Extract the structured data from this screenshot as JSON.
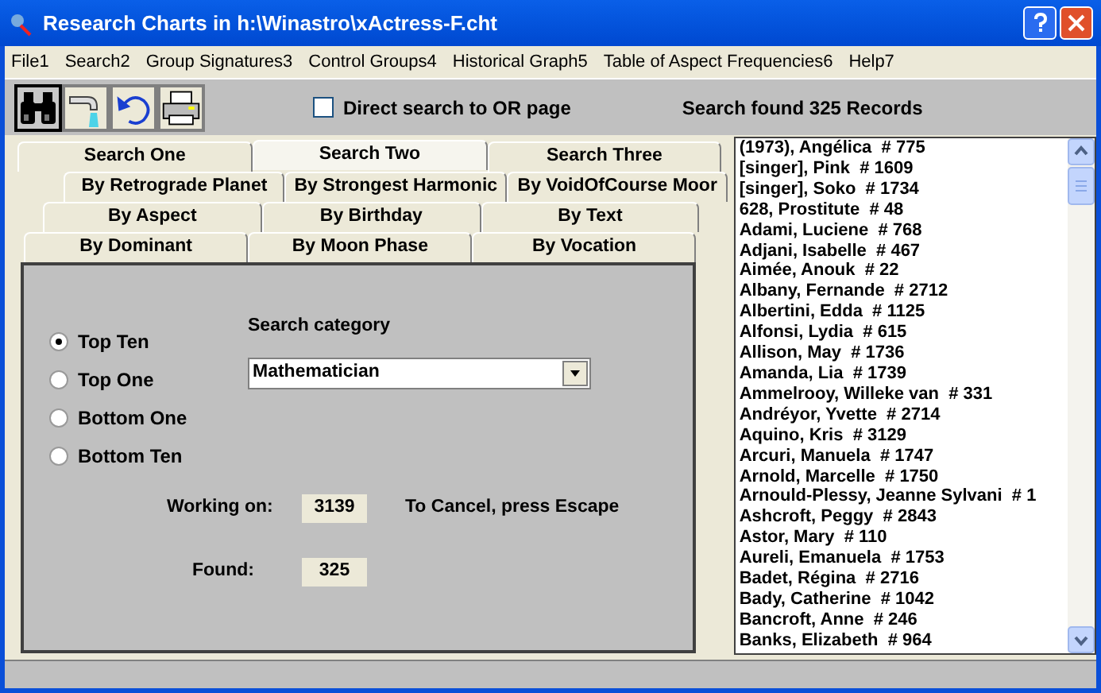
{
  "window": {
    "title": "Research Charts in h:\\Winastro\\xActress-F.cht"
  },
  "menu": [
    "File1",
    "Search2",
    "Group Signatures3",
    "Control Groups4",
    "Historical Graph5",
    "Table of Aspect Frequencies6",
    "Help7"
  ],
  "toolbar": {
    "buttons": [
      {
        "kind": "binoculars",
        "selected": true
      },
      {
        "kind": "pour",
        "selected": false
      },
      {
        "kind": "undo",
        "selected": false
      },
      {
        "kind": "print",
        "selected": false
      }
    ],
    "direct_search": {
      "label": "Direct search to OR page",
      "checked": false
    },
    "status": "Search found 325 Records"
  },
  "tab_rows": [
    [
      {
        "label": "Search One",
        "selected": false
      },
      {
        "label": "Search Two",
        "selected": true
      },
      {
        "label": "Search Three",
        "selected": false
      }
    ],
    [
      {
        "label": "By Retrograde Planet",
        "selected": false
      },
      {
        "label": "By Strongest Harmonic",
        "selected": false
      },
      {
        "label": "By VoidOfCourse Moor",
        "selected": false
      }
    ],
    [
      {
        "label": "By Aspect",
        "selected": false
      },
      {
        "label": "By Birthday",
        "selected": false
      },
      {
        "label": "By Text",
        "selected": false
      }
    ],
    [
      {
        "label": "By Dominant",
        "selected": false
      },
      {
        "label": "By Moon Phase",
        "selected": false
      },
      {
        "label": "By Vocation",
        "selected": false
      }
    ]
  ],
  "options": [
    {
      "label": "Top Ten",
      "selected": true
    },
    {
      "label": "Top One",
      "selected": false
    },
    {
      "label": "Bottom One",
      "selected": false
    },
    {
      "label": "Bottom Ten",
      "selected": false
    }
  ],
  "search_category": {
    "label": "Search category",
    "value": "Mathematician"
  },
  "working_on": {
    "label": "Working on:",
    "value": "3139",
    "hint": "To Cancel, press Escape"
  },
  "found": {
    "label": "Found:",
    "value": "325"
  },
  "records": [
    "(1973), Angélica  # 775",
    "[singer], Pink  # 1609",
    "[singer], Soko  # 1734",
    "628, Prostitute  # 48",
    "Adami, Luciene  # 768",
    "Adjani, Isabelle  # 467",
    "Aimée, Anouk  # 22",
    "Albany, Fernande  # 2712",
    "Albertini, Edda  # 1125",
    "Alfonsi, Lydia  # 615",
    "Allison, May  # 1736",
    "Amanda, Lia  # 1739",
    "Ammelrooy, Willeke van  # 331",
    "Andréyor, Yvette  # 2714",
    "Aquino, Kris  # 3129",
    "Arcuri, Manuela  # 1747",
    "Arnold, Marcelle  # 1750",
    "Arnould-Plessy, Jeanne Sylvani  # 1",
    "Ashcroft, Peggy  # 2843",
    "Astor, Mary  # 110",
    "Aureli, Emanuela  # 1753",
    "Badet, Régina  # 2716",
    "Bady, Catherine  # 1042",
    "Bancroft, Anne  # 246",
    "Banks, Elizabeth  # 964"
  ]
}
